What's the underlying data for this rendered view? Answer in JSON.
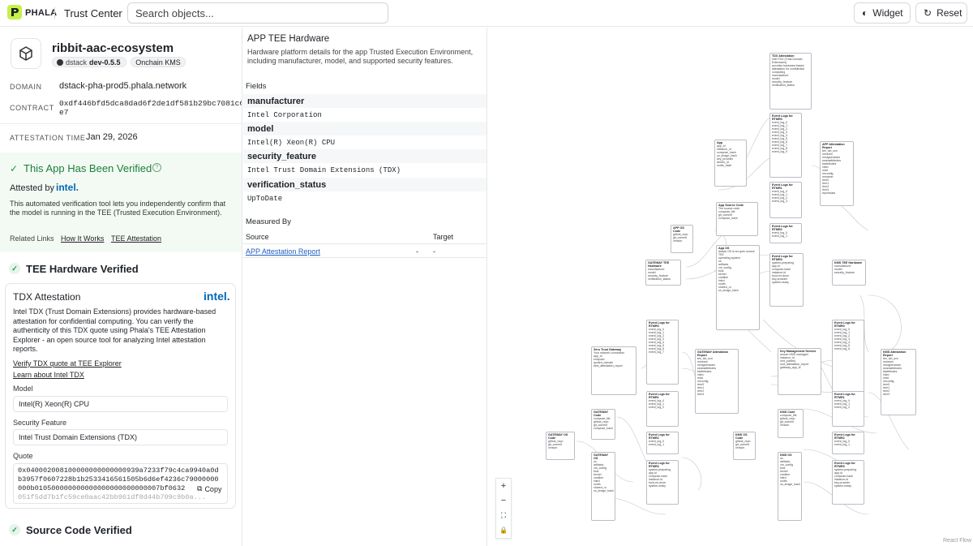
{
  "topbar": {
    "brand": "PHALA",
    "section": "Trust Center",
    "search_placeholder": "Search objects...",
    "widget_label": "Widget",
    "reset_label": "Reset"
  },
  "app": {
    "name": "ribbit-aac-ecosystem",
    "badge_dstack": "dstack",
    "version": "dev-0.5.5",
    "kms_badge": "Onchain KMS",
    "domain_label": "DOMAIN",
    "domain": "dstack-pha-prod5.phala.network",
    "contract_label": "CONTRACT",
    "contract_line1": "0xdf446bfd5dca8dad6f2de1df581b29bc7081c6",
    "contract_line2": "e7",
    "attestation_label": "ATTESTATION TIME",
    "attestation_time": "Jan 29, 2026"
  },
  "verified": {
    "title": "This App Has Been Verified",
    "attested_by": "Attested by",
    "intel": "intel.",
    "desc": "This automated verification tool lets you independently confirm that the model is running in the TEE (Trusted Execution Environment).",
    "related_label": "Related Links",
    "link1": "How It Works",
    "link2": "TEE Attestation"
  },
  "tee": {
    "heading": "TEE Hardware Verified",
    "card_title": "TDX Attestation",
    "intel": "intel.",
    "desc": "Intel TDX (Trust Domain Extensions) provides hardware-based attestation for confidential computing. You can verify the authenticity of this TDX quote using Phala's TEE Attestation Explorer - an open source tool for analyzing Intel attestation reports.",
    "link1": "Verify TDX quote at TEE Explorer",
    "link2": "Learn about Intel TDX",
    "model_label": "Model",
    "model": "Intel(R) Xeon(R) CPU",
    "sec_label": "Security Feature",
    "sec": "Intel Trust Domain Extensions (TDX)",
    "quote_label": "Quote",
    "quote_line1": "0x040002008100000000000000939a7233f79c4ca9940a0d",
    "quote_line2": "b3957f0607228b1b2533416561505b6d6ef4236c79000000",
    "quote_line3": "000b010500000000000000000000000007bf0632",
    "quote_line4": "051f5dd7b1fc59ce0aac42bb961df8d44b709c9b0a...",
    "copy": "Copy"
  },
  "source": {
    "heading": "Source Code Verified"
  },
  "detail": {
    "title": "APP TEE Hardware",
    "desc1": "Hardware platform details for the app Trusted Execution Environment,",
    "desc2": "including manufacturer, model, and supported security features.",
    "fields_label": "Fields",
    "fields": [
      {
        "k": "manufacturer",
        "v": "Intel Corporation"
      },
      {
        "k": "model",
        "v": "Intel(R) Xeon(R) CPU"
      },
      {
        "k": "security_feature",
        "v": "Intel Trust Domain Extensions (TDX)"
      },
      {
        "k": "verification_status",
        "v": "UpToDate"
      }
    ],
    "measured_label": "Measured By",
    "col_source": "Source",
    "col_target": "Target",
    "row_source": "APP Attestation Report",
    "row_dash1": "-",
    "row_dash2": "-"
  },
  "graph": {
    "attribution": "React Flow",
    "zoom_in": "+",
    "zoom_out": "−",
    "fit": "⛶",
    "lock": "🔒"
  },
  "colors": {
    "accent_green": "#1a9e45",
    "logo": "#c6f04a",
    "intel_blue": "#0068b5"
  }
}
